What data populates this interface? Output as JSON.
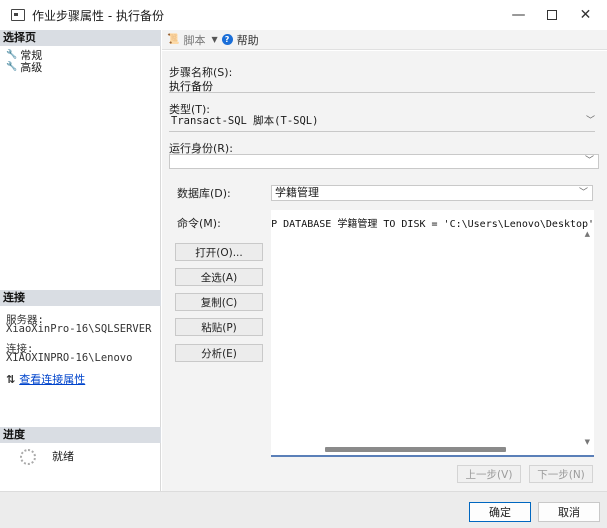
{
  "window": {
    "title": "作业步骤属性 - 执行备份",
    "minimize": "—",
    "close": "✕"
  },
  "left_pane": {
    "select_page_header": "选择页",
    "pages": [
      {
        "label": "常规",
        "icon": "wrench-icon"
      },
      {
        "label": "高级",
        "icon": "wrench-icon"
      }
    ],
    "connection_header": "连接",
    "server_label": "服务器:",
    "server_value": "XiaoXinPro-16\\SQLSERVER",
    "connection_label": "连接:",
    "connection_value": "XIAOXINPRO-16\\Lenovo",
    "view_properties_link": "查看连接属性",
    "progress_header": "进度",
    "status": "就绪"
  },
  "toolbar": {
    "script_label": "脚本",
    "help_label": "帮助"
  },
  "form": {
    "step_name_label": "步骤名称(S):",
    "step_name_value": "执行备份",
    "type_label": "类型(T):",
    "type_value": "Transact-SQL 脚本(T-SQL)",
    "run_as_label": "运行身份(R):",
    "run_as_value": "",
    "database_label": "数据库(D):",
    "database_value": "学籍管理",
    "command_label": "命令(M):",
    "command_text": "BACKUP DATABASE 学籍管理 TO DISK = 'C:\\Users\\Lenovo\\Desktop' WITH INIT;"
  },
  "command_buttons": {
    "open": "打开(O)...",
    "select_all": "全选(A)",
    "copy": "复制(C)",
    "paste": "粘贴(P)",
    "parse": "分析(E)"
  },
  "step_nav": {
    "prev": "上一步(V)",
    "next": "下一步(N)"
  },
  "footer": {
    "ok": "确定",
    "cancel": "取消"
  }
}
